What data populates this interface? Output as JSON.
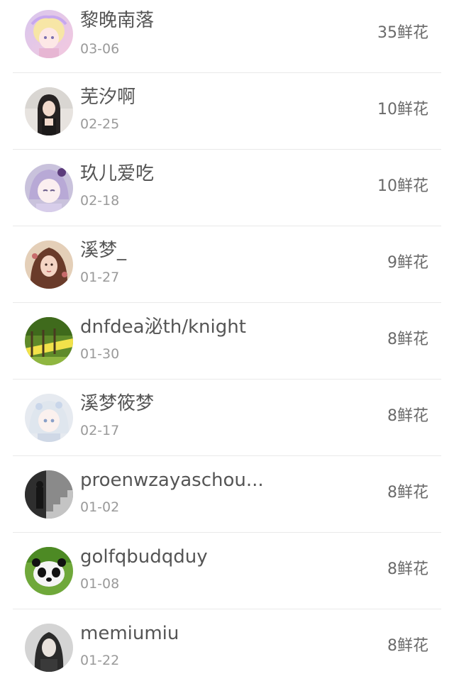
{
  "users": [
    {
      "name": "黎晚南落",
      "date": "03-06",
      "flowers": "35鲜花",
      "avatar": "anime-pink-avatar"
    },
    {
      "name": "芜汐啊",
      "date": "02-25",
      "flowers": "10鲜花",
      "avatar": "girl-photo-avatar"
    },
    {
      "name": "玖儿爱吃",
      "date": "02-18",
      "flowers": "10鲜花",
      "avatar": "anime-purple-avatar"
    },
    {
      "name": "溪梦_",
      "date": "01-27",
      "flowers": "9鲜花",
      "avatar": "painted-girl-avatar"
    },
    {
      "name": "dnfdea泌th/knight",
      "date": "01-30",
      "flowers": "8鲜花",
      "avatar": "forest-path-avatar"
    },
    {
      "name": "溪梦筱梦",
      "date": "02-17",
      "flowers": "8鲜花",
      "avatar": "anime-white-avatar"
    },
    {
      "name": "proenwzayaschou...",
      "date": "01-02",
      "flowers": "8鲜花",
      "avatar": "bw-stairs-avatar"
    },
    {
      "name": "golfqbudqduy",
      "date": "01-08",
      "flowers": "8鲜花",
      "avatar": "panda-avatar"
    },
    {
      "name": "memiumiu",
      "date": "01-22",
      "flowers": "8鲜花",
      "avatar": "bw-woman-avatar"
    }
  ]
}
